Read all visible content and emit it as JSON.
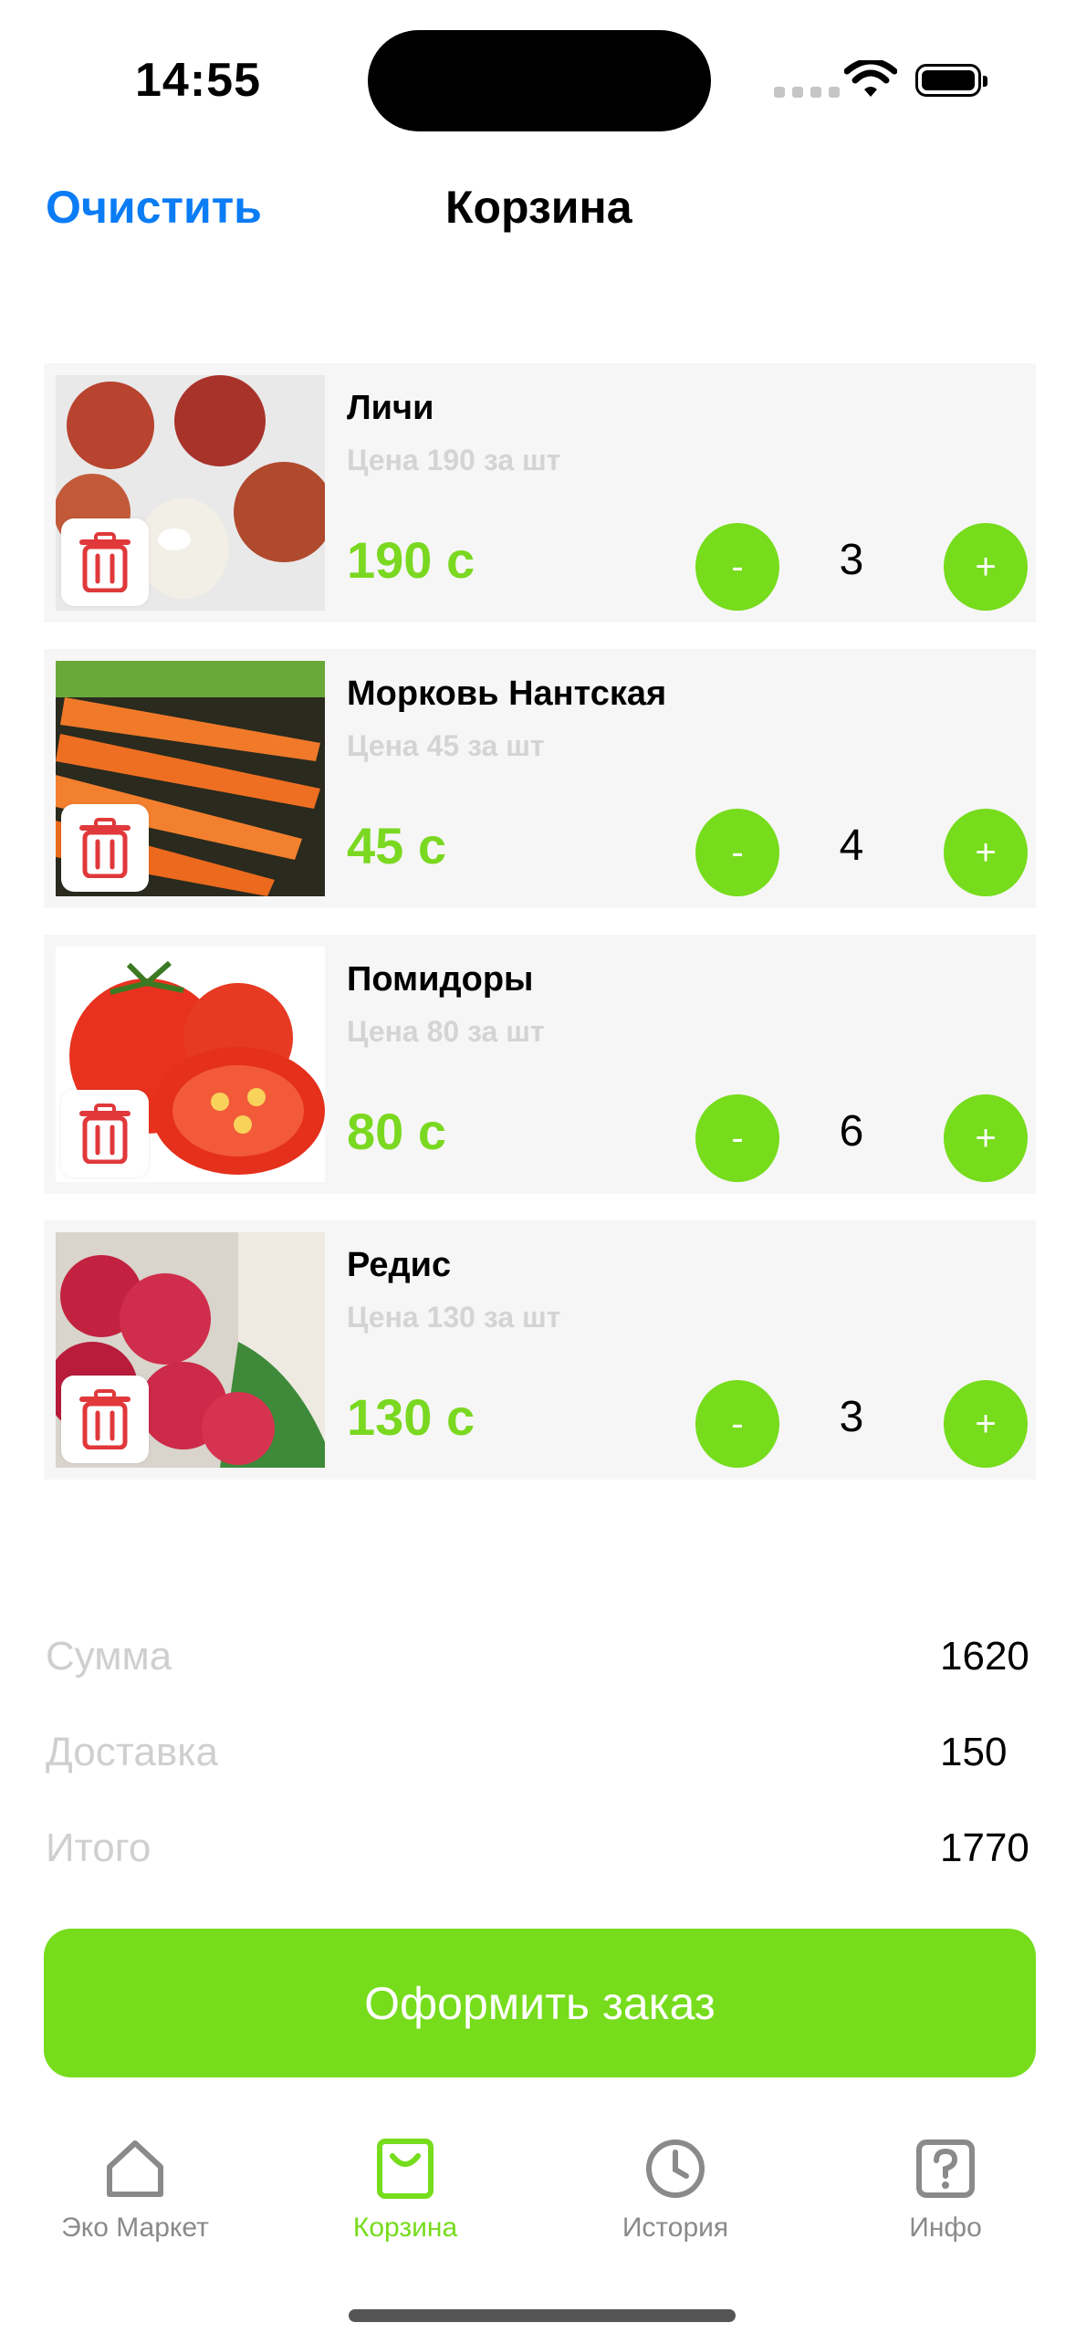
{
  "status_bar": {
    "time": "14:55"
  },
  "header": {
    "clear_label": "Очистить",
    "title": "Корзина"
  },
  "items": [
    {
      "name": "Личи",
      "price_each": "Цена 190 за шт",
      "price": "190 с",
      "qty": "3",
      "minus": "-",
      "plus": "+",
      "image": "lychee"
    },
    {
      "name": "Морковь Нантская",
      "price_each": "Цена 45 за шт",
      "price": "45 с",
      "qty": "4",
      "minus": "-",
      "plus": "+",
      "image": "carrots"
    },
    {
      "name": "Помидоры",
      "price_each": "Цена 80 за шт",
      "price": "80 с",
      "qty": "6",
      "minus": "-",
      "plus": "+",
      "image": "tomatoes"
    },
    {
      "name": "Редис",
      "price_each": "Цена 130 за шт",
      "price": "130 с",
      "qty": "3",
      "minus": "-",
      "plus": "+",
      "image": "radish"
    }
  ],
  "totals": {
    "sum_label": "Сумма",
    "sum_value": "1620",
    "delivery_label": "Доставка",
    "delivery_value": "150",
    "total_label": "Итого",
    "total_value": "1770"
  },
  "checkout_label": "Оформить заказ",
  "tabbar": [
    {
      "label": "Эко Маркет",
      "icon": "home-icon",
      "active": false
    },
    {
      "label": "Корзина",
      "icon": "bag-icon",
      "active": true
    },
    {
      "label": "История",
      "icon": "clock-icon",
      "active": false
    },
    {
      "label": "Инфо",
      "icon": "question-icon",
      "active": false
    }
  ],
  "colors": {
    "accent": "#76dc1c",
    "price": "#7ad820",
    "link": "#0a7cf5",
    "trash": "#e0383b"
  }
}
